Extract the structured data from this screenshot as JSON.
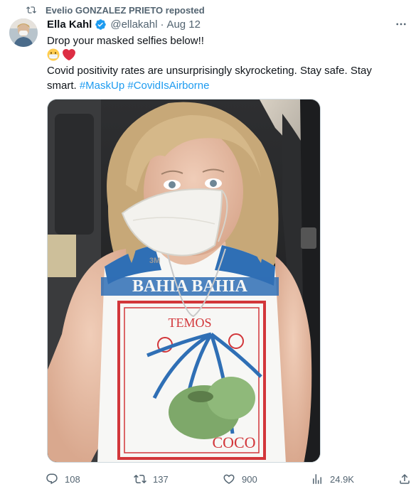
{
  "repost": {
    "text": "Evelio GONZALEZ PRIETO reposted"
  },
  "tweet": {
    "author_name": "Ella Kahl",
    "handle": "@ellakahl",
    "separator": "·",
    "date": "Aug 12",
    "line1": "Drop your masked selfies below!!",
    "emojis": [
      "mask-face-emoji",
      "red-heart-emoji"
    ],
    "line3": "Covid positivity rates are unsurprisingly skyrocketing. Stay safe. Stay",
    "line4_prefix": "smart.",
    "hashtags": [
      "#MaskUp",
      "#CovidIsAirborne"
    ]
  },
  "photo": {
    "shirt_text_top": "BAHIA BAHIA",
    "shirt_text_mid": "TEMOS",
    "shirt_text_bottom": "COCO",
    "mask_text": "3M"
  },
  "actions": {
    "replies": "108",
    "reposts": "137",
    "likes": "900",
    "views": "24.9K"
  },
  "colors": {
    "text": "#0f1419",
    "muted": "#536471",
    "accent": "#1d9bf0"
  }
}
